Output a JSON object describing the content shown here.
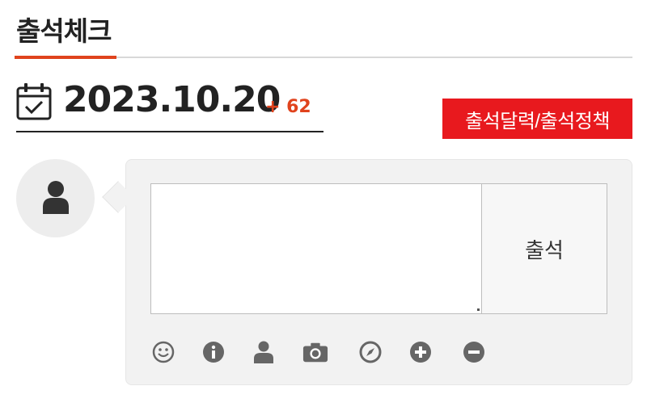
{
  "page": {
    "title": "출석체크"
  },
  "date_bar": {
    "date": "2023.10.20",
    "count": "+ 62"
  },
  "policy_button": {
    "label": "출석달력/출석정책"
  },
  "comment": {
    "value": "",
    "placeholder": ""
  },
  "submit_button": {
    "label": "출석"
  },
  "toolbar": {
    "icons": [
      "smiley-icon",
      "info-icon",
      "user-icon",
      "camera-icon",
      "compass-icon",
      "plus-circle-icon",
      "minus-circle-icon"
    ]
  },
  "colors": {
    "accent": "#e0431d",
    "button_red": "#e8191e",
    "panel_bg": "#f2f2f2",
    "icon_gray": "#666666"
  }
}
